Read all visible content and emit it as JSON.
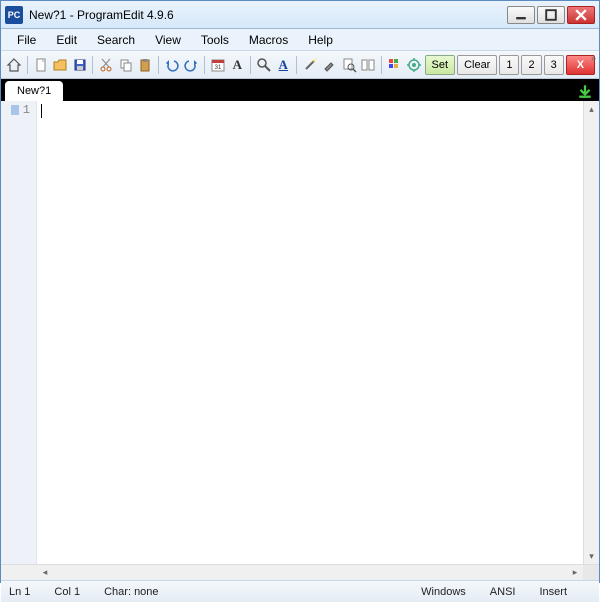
{
  "window": {
    "app_icon_text": "PC",
    "title": "New?1  -  ProgramEdit 4.9.6"
  },
  "menu": {
    "items": [
      "File",
      "Edit",
      "Search",
      "View",
      "Tools",
      "Macros",
      "Help"
    ]
  },
  "toolbar": {
    "set_label": "Set",
    "clear_label": "Clear",
    "b1": "1",
    "b2": "2",
    "b3": "3",
    "x_label": "X"
  },
  "tabs": {
    "active": "New?1"
  },
  "editor": {
    "line_number": "1",
    "content": ""
  },
  "status": {
    "ln": "Ln 1",
    "col": "Col 1",
    "char": "Char: none",
    "os": "Windows",
    "enc": "ANSI",
    "mode": "Insert"
  }
}
